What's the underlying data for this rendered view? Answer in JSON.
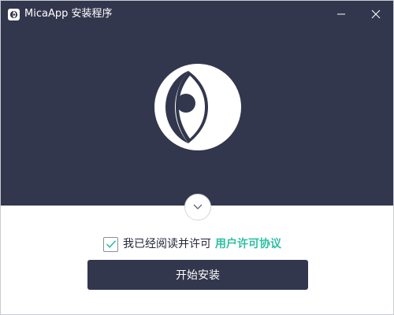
{
  "window": {
    "title": "MicaApp 安装程序",
    "app_icon": "eye-logo-icon",
    "minimize_icon": "minimize-icon",
    "close_icon": "close-icon"
  },
  "colors": {
    "header_bg": "#33374d",
    "accent_link": "#2fbfa4",
    "button_bg": "#33374d"
  },
  "hero": {
    "logo_icon": "eye-logo-icon"
  },
  "toggle": {
    "icon": "chevron-down-icon"
  },
  "agreement": {
    "checked": true,
    "text": "我已经阅读并许可",
    "link_label": "用户许可协议"
  },
  "actions": {
    "install_label": "开始安装"
  }
}
